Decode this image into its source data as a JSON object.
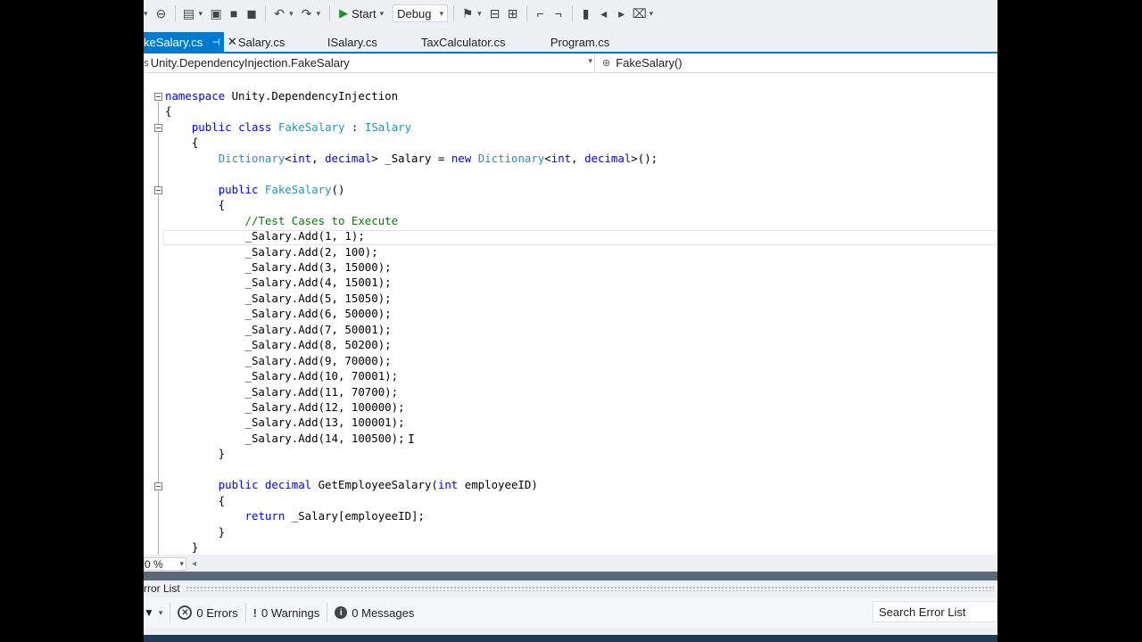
{
  "toolbar": {
    "start_label": "Start",
    "configuration": "Debug"
  },
  "tabs": [
    {
      "label": "keSalary.cs",
      "active": true
    },
    {
      "label": "Salary.cs",
      "active": false
    },
    {
      "label": "ISalary.cs",
      "active": false
    },
    {
      "label": "TaxCalculator.cs",
      "active": false
    },
    {
      "label": "Program.cs",
      "active": false
    }
  ],
  "navbar": {
    "type_path": "Unity.DependencyInjection.FakeSalary",
    "member": "FakeSalary()"
  },
  "code_lines": [
    "namespace Unity.DependencyInjection",
    "{",
    "    public class FakeSalary : ISalary",
    "    {",
    "        Dictionary<int, decimal> _Salary = new Dictionary<int, decimal>();",
    "",
    "        public FakeSalary()",
    "        {",
    "            //Test Cases to Execute",
    "            _Salary.Add(1, 1);",
    "            _Salary.Add(2, 100);",
    "            _Salary.Add(3, 15000);",
    "            _Salary.Add(4, 15001);",
    "            _Salary.Add(5, 15050);",
    "            _Salary.Add(6, 50000);",
    "            _Salary.Add(7, 50001);",
    "            _Salary.Add(8, 50200);",
    "            _Salary.Add(9, 70000);",
    "            _Salary.Add(10, 70001);",
    "            _Salary.Add(11, 70700);",
    "            _Salary.Add(12, 100000);",
    "            _Salary.Add(13, 100001);",
    "            _Salary.Add(14, 100500);",
    "        }",
    "",
    "        public decimal GetEmployeeSalary(int employeeID)",
    "        {",
    "            return _Salary[employeeID];",
    "        }",
    "    }"
  ],
  "zoom": "0 %",
  "error_list": {
    "title": "rror List",
    "errors": "0 Errors",
    "warnings": "0 Warnings",
    "messages": "0 Messages",
    "search_placeholder": "Search Error List"
  },
  "colors": {
    "accent": "#007acc",
    "keyword": "#0000ff",
    "type": "#2b91af",
    "comment": "#008000"
  }
}
